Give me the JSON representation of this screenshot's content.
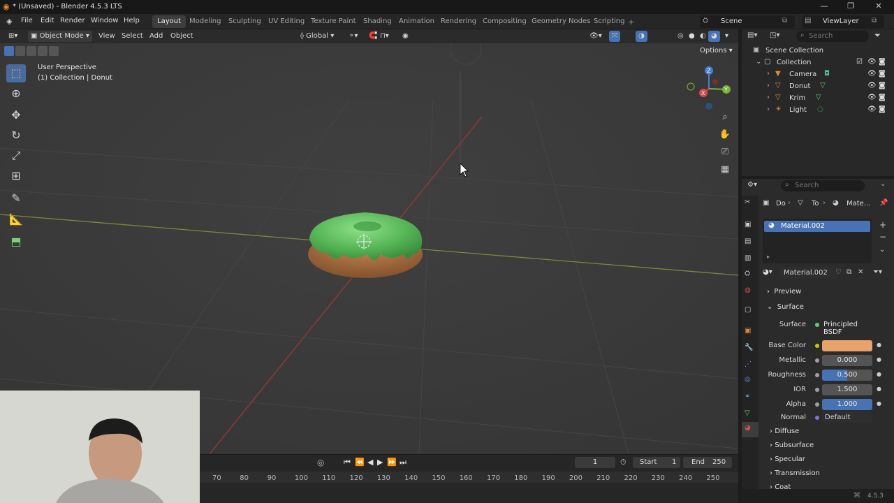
{
  "window": {
    "title": "* (Unsaved) - Blender 4.5.3 LTS",
    "minimize": "—",
    "maximize": "❐",
    "close": "✕"
  },
  "menu": [
    "File",
    "Edit",
    "Render",
    "Window",
    "Help"
  ],
  "workspaces": [
    "Layout",
    "Modeling",
    "Sculpting",
    "UV Editing",
    "Texture Paint",
    "Shading",
    "Animation",
    "Rendering",
    "Compositing",
    "Geometry Nodes",
    "Scripting"
  ],
  "active_workspace": "Layout",
  "add_workspace": "+",
  "scene": {
    "label": "Scene",
    "view_layer": "ViewLayer"
  },
  "viewport": {
    "mode": "Object Mode",
    "menus": [
      "View",
      "Select",
      "Add",
      "Object"
    ],
    "transform": "Global",
    "info_line1": "User Perspective",
    "info_line2": "(1) Collection | Donut",
    "options": "Options"
  },
  "gizmo": {
    "z": "Z",
    "y": "Y",
    "x": "X"
  },
  "timeline": {
    "frame": "1",
    "start_label": "Start",
    "start": "1",
    "end_label": "End",
    "end": "250",
    "ticks": [
      "70",
      "80",
      "90",
      "100",
      "110",
      "120",
      "130",
      "140",
      "150",
      "160",
      "170",
      "180",
      "190",
      "200",
      "210",
      "220",
      "230",
      "240",
      "250"
    ]
  },
  "outliner": {
    "search_placeholder": "Search",
    "root": "Scene Collection",
    "collection": "Collection",
    "items": [
      {
        "name": "Camera",
        "icon": "camera-icon"
      },
      {
        "name": "Donut",
        "icon": "mesh-icon"
      },
      {
        "name": "Krim",
        "icon": "mesh-icon"
      },
      {
        "name": "Light",
        "icon": "light-icon"
      }
    ]
  },
  "properties": {
    "search_placeholder": "Search",
    "breadcrumb": [
      "Do",
      "To",
      "Mate..."
    ],
    "slot": "Material.002",
    "material_name": "Material.002",
    "sections": {
      "preview": "Preview",
      "surface": "Surface"
    },
    "surface_label": "Surface",
    "surface_value": "Principled BSDF",
    "fields": [
      {
        "label": "Base Color",
        "value": "",
        "type": "color",
        "fill": 1
      },
      {
        "label": "Metallic",
        "value": "0.000",
        "type": "num",
        "fill": 0
      },
      {
        "label": "Roughness",
        "value": "0.500",
        "type": "num",
        "fill": 0.5
      },
      {
        "label": "IOR",
        "value": "1.500",
        "type": "num",
        "fill": 0
      },
      {
        "label": "Alpha",
        "value": "1.000",
        "type": "num",
        "fill": 1
      }
    ],
    "normal_label": "Normal",
    "normal_value": "Default",
    "subsections": [
      "Diffuse",
      "Subsurface",
      "Specular",
      "Transmission",
      "Coat"
    ]
  },
  "status": {
    "version": "4.5.3"
  },
  "colors": {
    "accent": "#4772b3",
    "base_color": "#e8a26a",
    "donut_icing": "#5cb85c"
  }
}
